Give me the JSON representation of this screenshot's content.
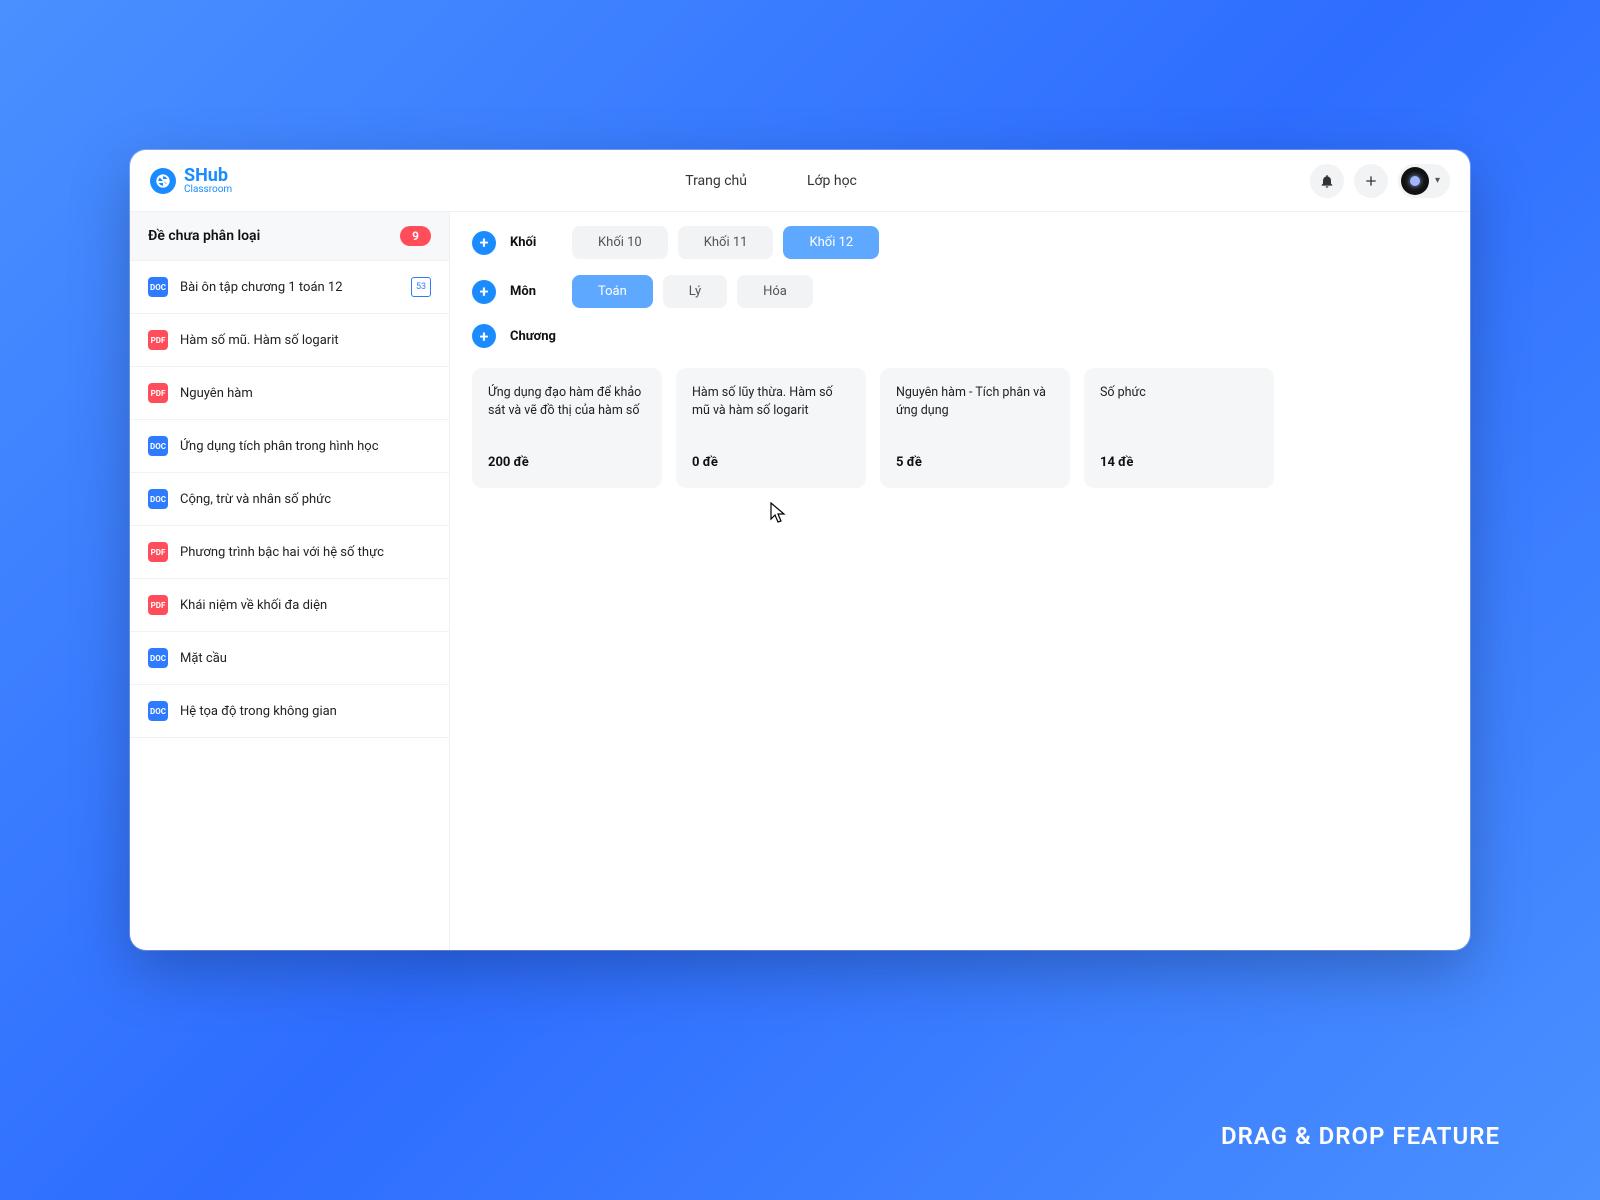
{
  "footer_caption": "DRAG & DROP FEATURE",
  "brand": {
    "name": "SHub",
    "subtitle": "Classroom"
  },
  "nav": {
    "home": "Trang chủ",
    "class": "Lớp học"
  },
  "sidebar": {
    "uncategorized_label": "Đề chưa phân loại",
    "uncategorized_badge": "9",
    "items": [
      {
        "type": "doc",
        "label": "Bài ôn tập chương 1 toán 12",
        "trail": "53"
      },
      {
        "type": "pdf",
        "label": "Hàm số mũ. Hàm số logarit"
      },
      {
        "type": "pdf",
        "label": "Nguyên hàm"
      },
      {
        "type": "doc",
        "label": "Ứng dụng tích phân trong hình học"
      },
      {
        "type": "doc",
        "label": "Cộng, trừ và nhân số phức"
      },
      {
        "type": "pdf",
        "label": "Phương trình bậc hai với hệ số thực"
      },
      {
        "type": "pdf",
        "label": "Khái niệm về khối đa diện"
      },
      {
        "type": "doc",
        "label": "Mặt cầu"
      },
      {
        "type": "doc",
        "label": "Hệ tọa độ trong không gian"
      }
    ]
  },
  "filters": {
    "grade_label": "Khối",
    "grades": [
      {
        "label": "Khối 10",
        "active": false
      },
      {
        "label": "Khối 11",
        "active": false
      },
      {
        "label": "Khối 12",
        "active": true
      }
    ],
    "subject_label": "Môn",
    "subjects": [
      {
        "label": "Toán",
        "active": true
      },
      {
        "label": "Lý",
        "active": false
      },
      {
        "label": "Hóa",
        "active": false
      }
    ],
    "chapter_label": "Chương"
  },
  "chapters": [
    {
      "title": "Ứng dụng đạo hàm để khảo sát và vẽ đồ thị của hàm số",
      "count": "200 đề"
    },
    {
      "title": "Hàm số lũy thừa. Hàm số mũ và hàm số logarit",
      "count": "0 đề"
    },
    {
      "title": "Nguyên hàm - Tích phân và ứng dụng",
      "count": "5 đề"
    },
    {
      "title": "Số phức",
      "count": "14 đề"
    }
  ],
  "icons": {
    "doc": "DOC",
    "pdf": "PDF",
    "plus": "+"
  }
}
